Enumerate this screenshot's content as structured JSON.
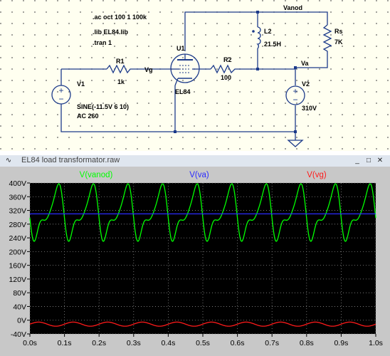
{
  "schematic": {
    "directives": [
      ".ac oct 100 1 100k",
      ".lib EL84.lib",
      ".tran 1"
    ],
    "net_labels": {
      "vanod": "Vanod",
      "va": "Va",
      "vg": "Vg"
    },
    "components": {
      "v1": {
        "name": "V1",
        "line1": "SINE(-11.5V 6 10)",
        "line2": "AC 260"
      },
      "r1": {
        "name": "R1",
        "value": "1k"
      },
      "u1": {
        "name": "U1",
        "model": "EL84"
      },
      "r2": {
        "name": "R2",
        "value": "100"
      },
      "l2": {
        "name": "L2",
        "value": "21.5H"
      },
      "rs": {
        "name": "Rs",
        "value": "7K"
      },
      "v2": {
        "name": "V2",
        "value": "310V"
      }
    }
  },
  "waveform_window": {
    "title": "EL84 load transformator.raw",
    "buttons": {
      "minimize": "_",
      "maximize": "□",
      "close": "✕"
    }
  },
  "chart_data": {
    "type": "line",
    "xlabel": "",
    "ylabel": "",
    "xlim": [
      0,
      1.0
    ],
    "ylim": [
      -40,
      400
    ],
    "x_ticks": [
      "0.0s",
      "0.1s",
      "0.2s",
      "0.3s",
      "0.4s",
      "0.5s",
      "0.6s",
      "0.7s",
      "0.8s",
      "0.9s",
      "1.0s"
    ],
    "y_ticks": [
      "400V",
      "360V",
      "320V",
      "280V",
      "240V",
      "200V",
      "160V",
      "120V",
      "80V",
      "40V",
      "0V",
      "-40V"
    ],
    "grid": true,
    "legend": "top",
    "background": "#000000",
    "series": [
      {
        "name": "V(vanod)",
        "color": "#00ff00",
        "frequency_hz": 10,
        "offset": 310,
        "min": 222,
        "max": 400
      },
      {
        "name": "V(va)",
        "color": "#2a2aff",
        "constant": 310
      },
      {
        "name": "V(vg)",
        "color": "#ff1a1a",
        "frequency_hz": 10,
        "offset": -11.5,
        "amplitude": 6
      }
    ]
  }
}
